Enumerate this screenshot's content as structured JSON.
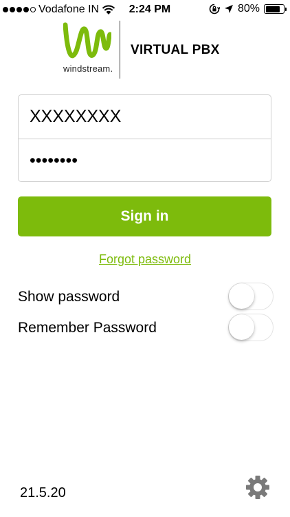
{
  "status_bar": {
    "carrier": "Vodafone IN",
    "time": "2:24 PM",
    "battery_percent": "80%",
    "battery_level": 0.8,
    "signal_bars": 4,
    "signal_max": 5
  },
  "brand": {
    "logo_text": "windstream.",
    "app_title": "VIRTUAL PBX",
    "logo_color": "#7dbb0c"
  },
  "login": {
    "username_value": "XXXXXXXX",
    "password_value": "••••••••",
    "signin_label": "Sign in",
    "forgot_label": "Forgot password"
  },
  "options": {
    "show_password_label": "Show password",
    "show_password_on": false,
    "remember_password_label": "Remember Password",
    "remember_password_on": false
  },
  "footer": {
    "version": "21.5.20"
  },
  "icons": [
    "wifi-icon",
    "orientation-lock-icon",
    "location-arrow-icon",
    "battery-icon",
    "gear-icon"
  ],
  "colors": {
    "accent": "#7dbb0c",
    "text": "#000000",
    "field_border": "#cfcfcf"
  }
}
